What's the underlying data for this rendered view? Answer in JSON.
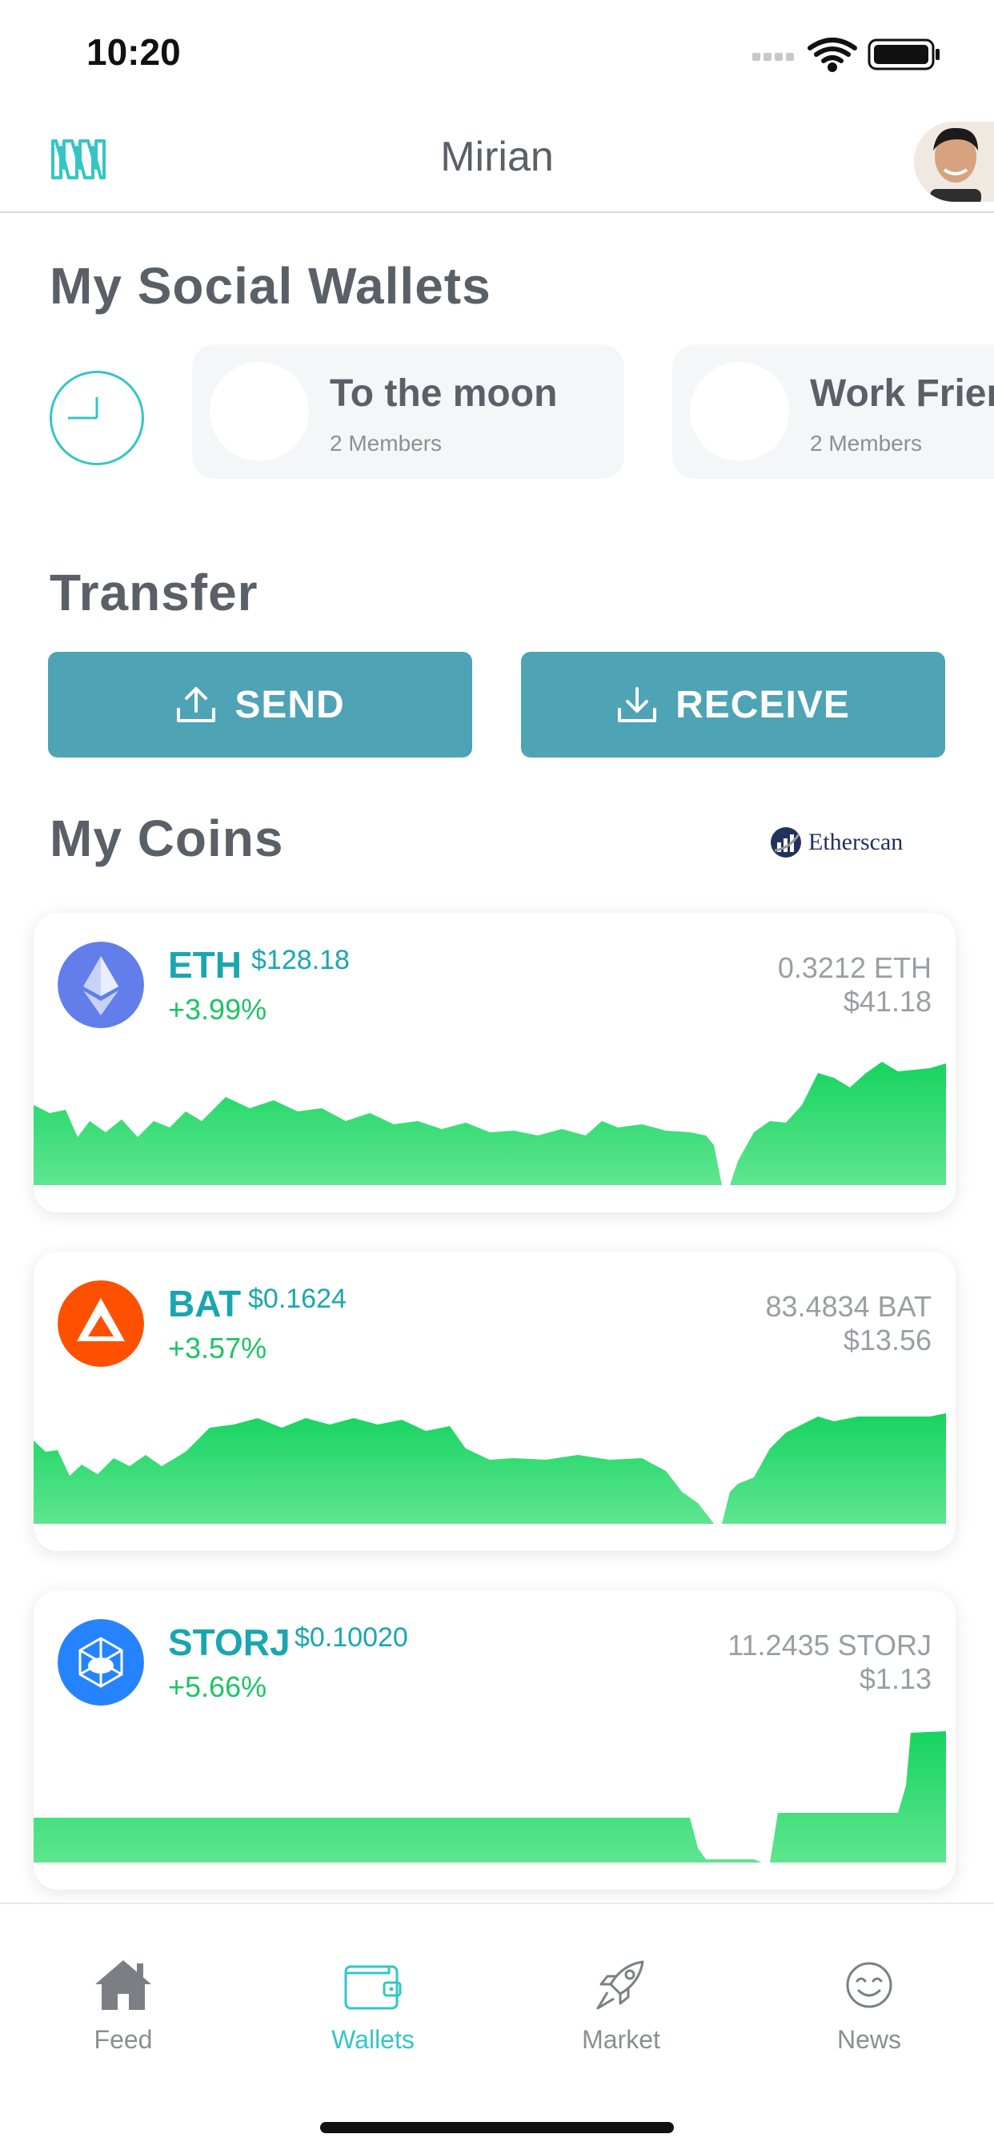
{
  "status_bar": {
    "time": "10:20"
  },
  "header": {
    "title": "Mirian"
  },
  "wallets": {
    "title": "My Social Wallets",
    "items": [
      {
        "name": "To the moon",
        "members": "2 Members"
      },
      {
        "name": "Work Frien",
        "members": "2 Members"
      }
    ]
  },
  "transfer": {
    "title": "Transfer",
    "send_label": "SEND",
    "receive_label": "RECEIVE"
  },
  "coins": {
    "title": "My Coins",
    "etherscan_label": "Etherscan",
    "items": [
      {
        "symbol": "ETH",
        "price": "$128.18",
        "change": "+3.99%",
        "amount": "0.3212 ETH",
        "value": "$41.18",
        "color": "#627eea"
      },
      {
        "symbol": "BAT",
        "price": "$0.1624",
        "change": "+3.57%",
        "amount": "83.4834 BAT",
        "value": "$13.56",
        "color": "#ff5000"
      },
      {
        "symbol": "STORJ",
        "price": "$0.10020",
        "change": "+5.66%",
        "amount": "11.2435 STORJ",
        "value": "$1.13",
        "color": "#2683ff"
      }
    ]
  },
  "tabbar": {
    "items": [
      {
        "label": "Feed",
        "icon": "home-icon",
        "active": false
      },
      {
        "label": "Wallets",
        "icon": "wallet-icon",
        "active": true
      },
      {
        "label": "Market",
        "icon": "rocket-icon",
        "active": false
      },
      {
        "label": "News",
        "icon": "smiley-icon",
        "active": false
      }
    ]
  },
  "colors": {
    "accent": "#33c6c4",
    "button": "#4ea3b5",
    "positive": "#1dc463",
    "text": "#5a6068"
  }
}
